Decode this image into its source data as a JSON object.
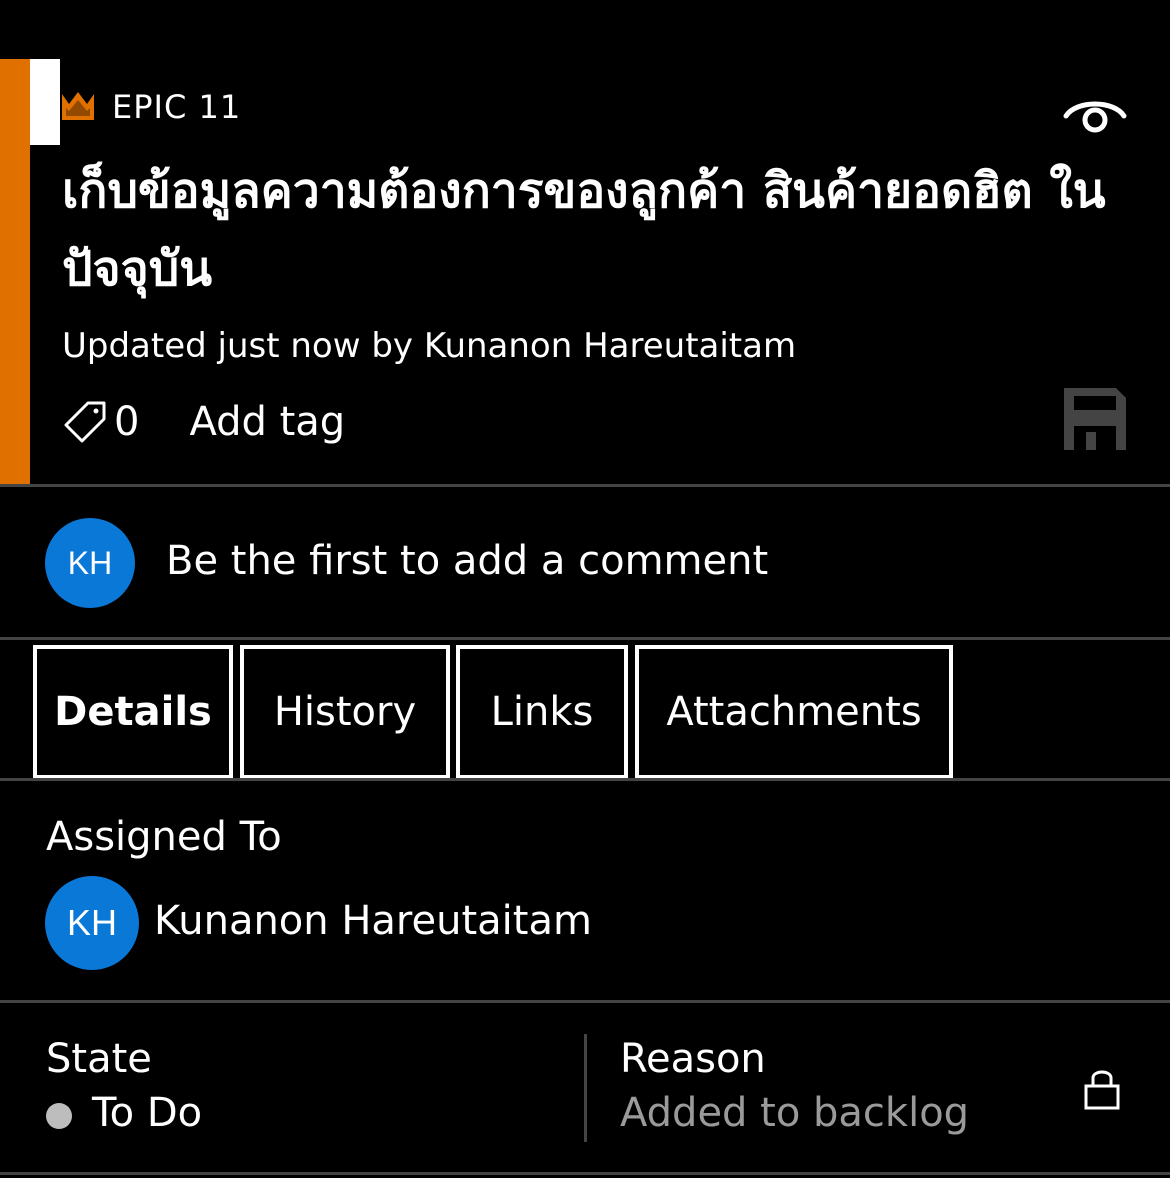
{
  "colors": {
    "accent": "#e07000",
    "avatar": "#0a78d7",
    "divider": "#444444",
    "state_dot": "#bdbdbd",
    "muted_text": "#9a9a9a"
  },
  "header": {
    "type_label": "EPIC 11",
    "type_icon": "crown-icon",
    "title": "เก็บข้อมูลความต้องการของลูกค้า สินค้ายอดฮิต ในปัจจุบัน",
    "updated": "Updated just now by Kunanon Hareutaitam",
    "tag_count": "0",
    "add_tag_label": "Add tag",
    "follow_icon": "eye-icon",
    "save_icon": "save-icon"
  },
  "comment": {
    "avatar_initials": "KH",
    "placeholder": "Be the first to add a comment"
  },
  "tabs": [
    {
      "label": "Details",
      "selected": true
    },
    {
      "label": "History",
      "selected": false
    },
    {
      "label": "Links",
      "selected": false
    },
    {
      "label": "Attachments",
      "selected": false
    }
  ],
  "assigned": {
    "label": "Assigned To",
    "avatar_initials": "KH",
    "name": "Kunanon Hareutaitam"
  },
  "state": {
    "label": "State",
    "value": "To Do"
  },
  "reason": {
    "label": "Reason",
    "value": "Added to backlog",
    "lock_icon": "lock-icon"
  }
}
